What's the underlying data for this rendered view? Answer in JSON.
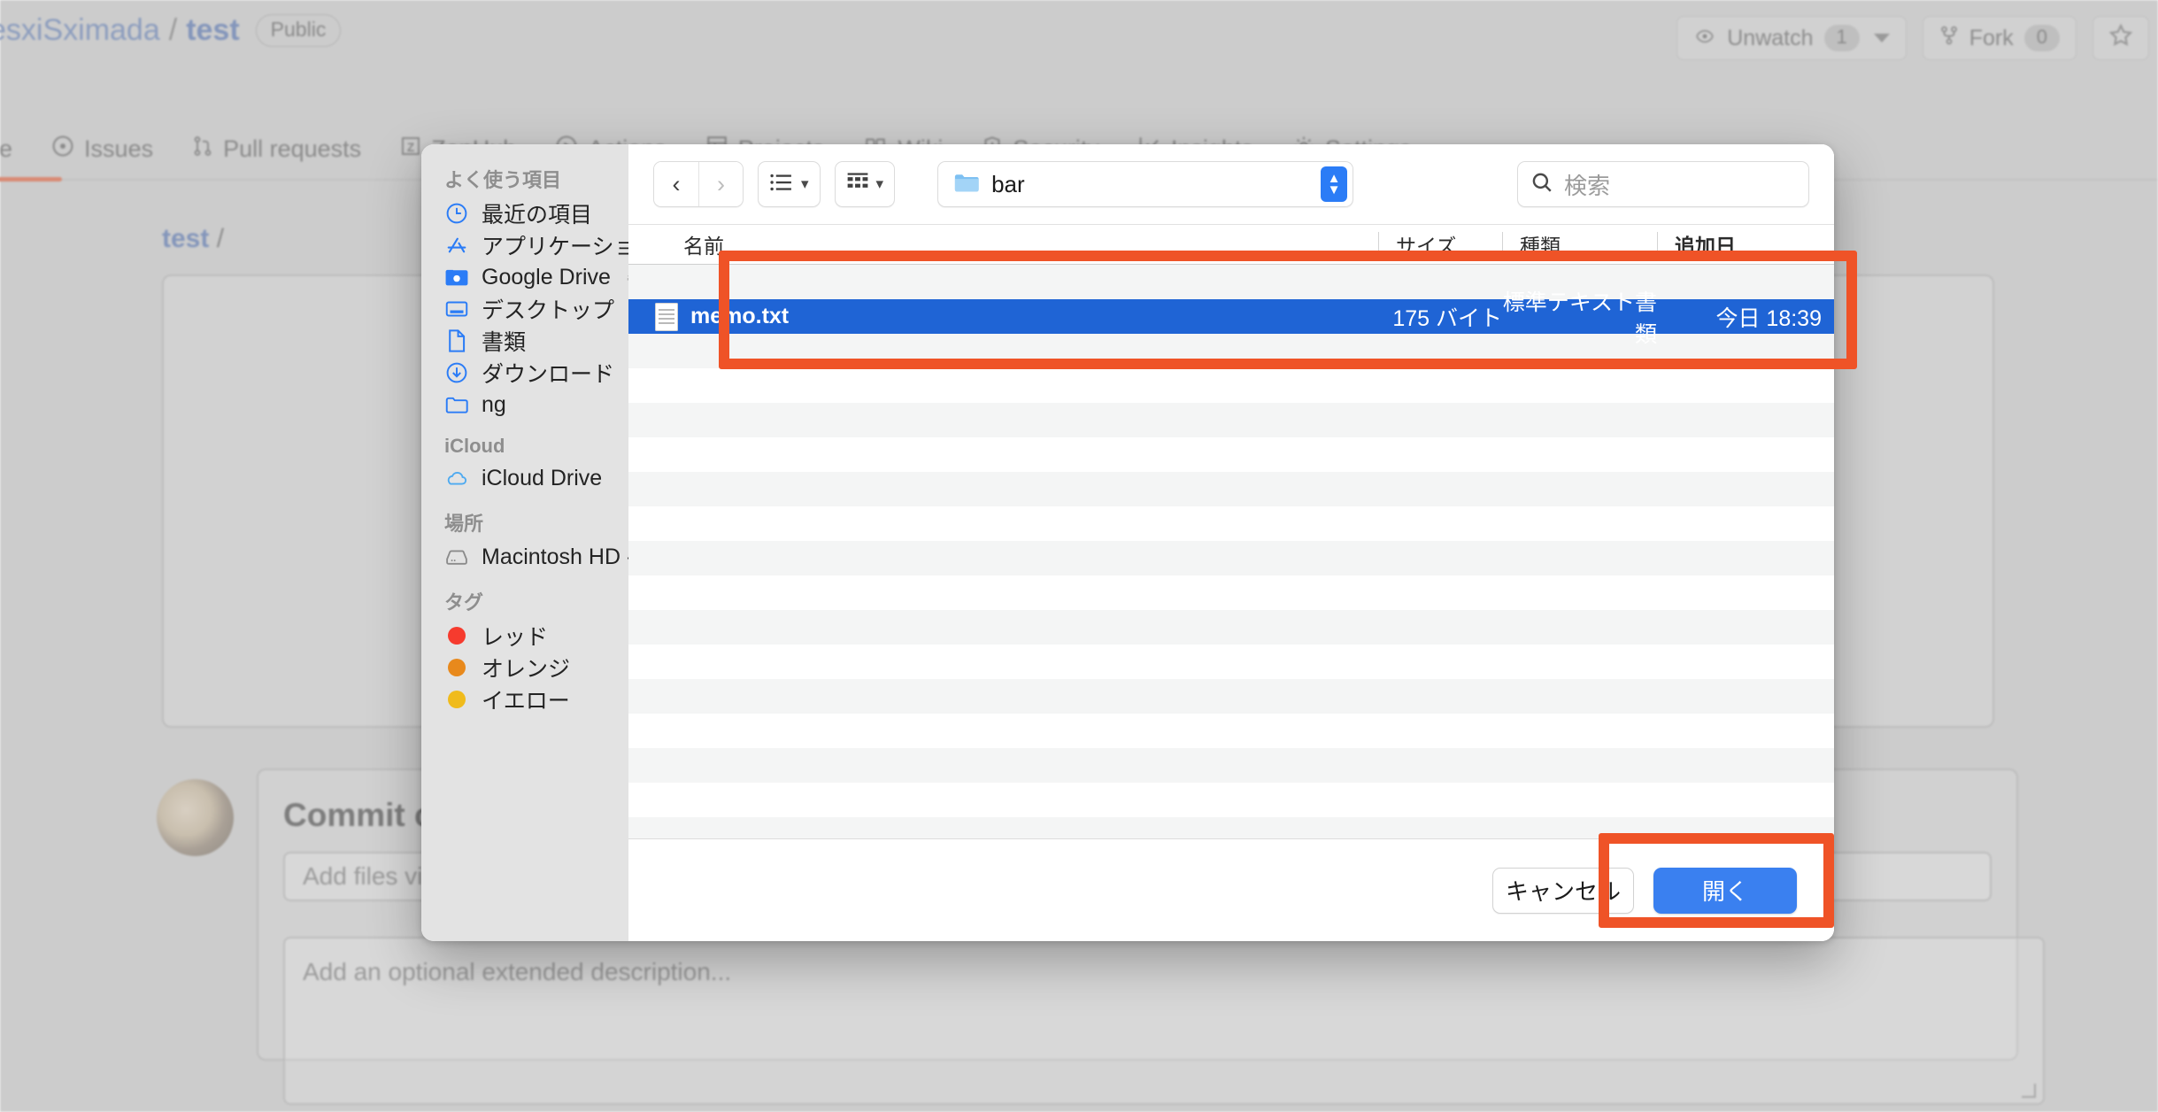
{
  "github": {
    "breadcrumb": {
      "owner": "esxiSximada",
      "separator": "/",
      "repo": "test",
      "visibility": "Public"
    },
    "actions": [
      {
        "name": "unwatch",
        "icon": "eye-icon",
        "label": "Unwatch",
        "count": "1",
        "has_caret": true
      },
      {
        "name": "fork",
        "icon": "fork-icon",
        "label": "Fork",
        "count": "0",
        "has_caret": false
      },
      {
        "name": "star",
        "icon": "star-icon",
        "label": "",
        "count": "",
        "has_caret": false
      }
    ],
    "nav": [
      {
        "icon": "code-icon",
        "label": "de"
      },
      {
        "icon": "issue-opened-icon",
        "label": "Issues"
      },
      {
        "icon": "git-pull-request-icon",
        "label": "Pull requests"
      },
      {
        "icon": "zenhub-icon",
        "label": "ZenHub"
      },
      {
        "icon": "play-icon",
        "label": "Actions"
      },
      {
        "icon": "table-icon",
        "label": "Projects"
      },
      {
        "icon": "book-icon",
        "label": "Wiki"
      },
      {
        "icon": "shield-icon",
        "label": "Security"
      },
      {
        "icon": "graph-icon",
        "label": "Insights"
      },
      {
        "icon": "gear-icon",
        "label": "Settings"
      }
    ],
    "path": {
      "repo": "test",
      "slash": "/"
    },
    "commit": {
      "title": "Commit c",
      "message_placeholder": "Add files vi",
      "description_placeholder": "Add an optional extended description..."
    }
  },
  "dialog": {
    "sidebar": {
      "groups": [
        {
          "title": "よく使う項目",
          "items": [
            {
              "icon": "clock-icon",
              "label": "最近の項目",
              "eject": false
            },
            {
              "icon": "applications-icon",
              "label": "アプリケーション",
              "eject": false
            },
            {
              "icon": "google-drive-folder-icon",
              "label": "Google Drive",
              "eject": true
            },
            {
              "icon": "desktop-icon",
              "label": "デスクトップ",
              "eject": false
            },
            {
              "icon": "document-icon",
              "label": "書類",
              "eject": false
            },
            {
              "icon": "download-icon",
              "label": "ダウンロード",
              "eject": false
            },
            {
              "icon": "folder-icon",
              "label": "ng",
              "eject": false
            }
          ]
        },
        {
          "title": "iCloud",
          "items": [
            {
              "icon": "cloud-icon",
              "label": "iCloud Drive",
              "eject": false
            }
          ]
        },
        {
          "title": "場所",
          "items": [
            {
              "icon": "harddisk-icon",
              "label": "Macintosh HD - Data",
              "eject": false
            }
          ]
        },
        {
          "title": "タグ",
          "items": [
            {
              "icon": "tag-dot-icon",
              "label": "レッド",
              "color": "#f63b2e",
              "eject": false
            },
            {
              "icon": "tag-dot-icon",
              "label": "オレンジ",
              "color": "#e8891c",
              "eject": false
            },
            {
              "icon": "tag-dot-icon",
              "label": "イエロー",
              "color": "#f0bb1c",
              "eject": false
            }
          ]
        }
      ]
    },
    "toolbar": {
      "back_icon": "chevron-left-icon",
      "forward_icon": "chevron-right-icon",
      "list_view_icon": "list-view-icon",
      "group_view_icon": "group-view-icon",
      "chevron_icon": "chevron-down-icon",
      "path_popup": {
        "folder_icon": "folder-icon",
        "label": "bar",
        "stepper_icon": "stepper-updown-icon"
      },
      "search": {
        "icon": "search-icon",
        "placeholder": "検索",
        "value": ""
      }
    },
    "columns": [
      {
        "key": "name",
        "label": "名前"
      },
      {
        "key": "size",
        "label": "サイズ"
      },
      {
        "key": "kind",
        "label": "種類"
      },
      {
        "key": "date",
        "label": "追加日"
      }
    ],
    "files": [
      {
        "icon": "text-file-icon",
        "name": "memo.txt",
        "size": "175 バイト",
        "kind": "標準テキスト書類",
        "date": "今日 18:39",
        "selected": true
      }
    ],
    "footer": {
      "cancel_label": "キャンセル",
      "open_label": "開く"
    }
  },
  "annotations": {
    "color": "#ef5327",
    "boxes": [
      {
        "name": "file-list-highlight",
        "target": "file list header and selected row"
      },
      {
        "name": "open-button-highlight",
        "target": "開く button"
      }
    ]
  }
}
